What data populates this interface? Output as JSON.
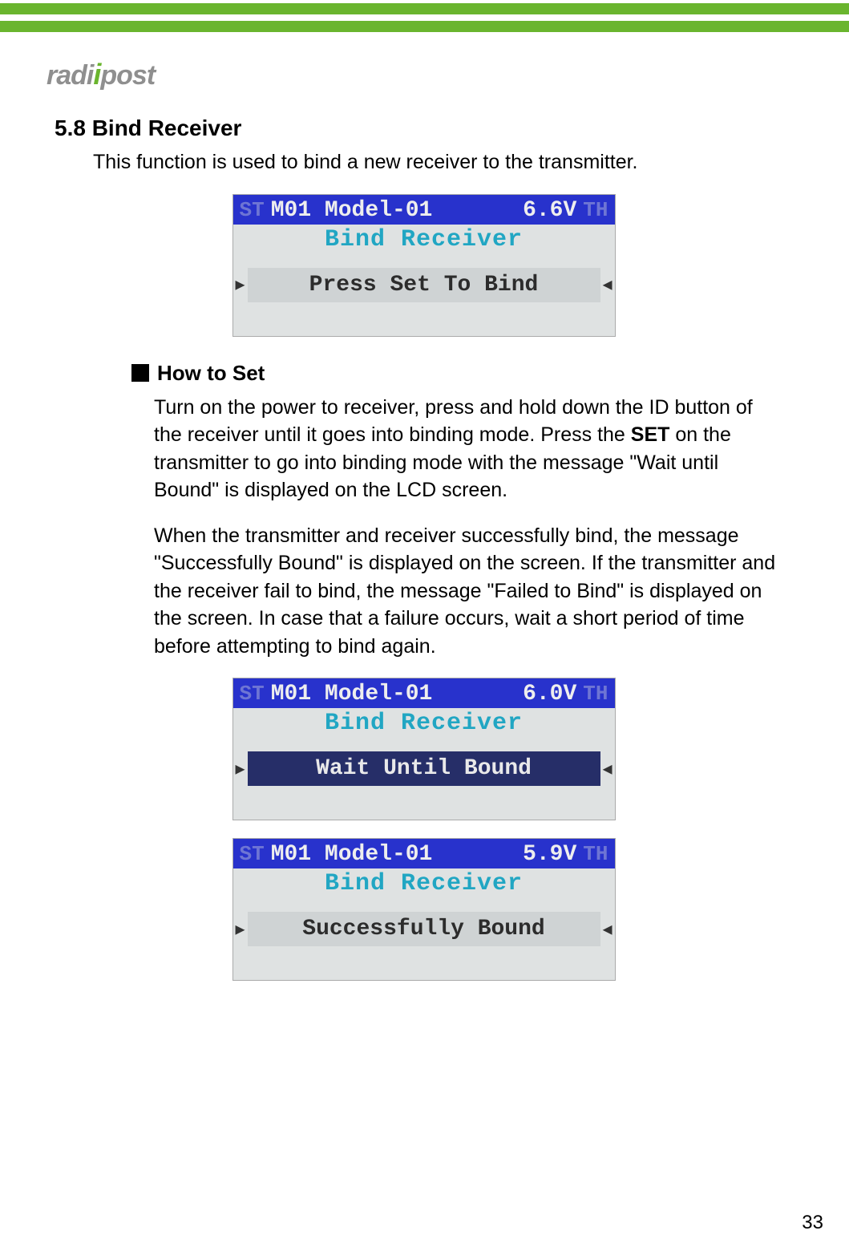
{
  "logo": {
    "pre": "radi",
    "accent": "i",
    "post": "post"
  },
  "section": {
    "title": "5.8 Bind Receiver",
    "lead": "This function is used to bind a new receiver to the transmitter.",
    "sub": "How to Set",
    "p1a": "Turn on the power to receiver, press and hold down the ID button of the receiver until it goes into binding mode. Press the ",
    "p1b": "SET",
    "p1c": " on the transmitter to go into binding mode with the message \"Wait until Bound\" is displayed on the LCD screen.",
    "p2": "When the transmitter and receiver successfully bind, the message \"Successfully Bound\" is displayed on the screen. If the transmitter and the receiver fail to bind, the message \"Failed to Bind\" is displayed on the screen. In case that a failure occurs, wait a short period of time before attempting to bind again."
  },
  "lcd": [
    {
      "st": "ST",
      "model": "M01 Model-01",
      "volt": "6.6V",
      "th": "TH",
      "title": "Bind Receiver",
      "bar": "Press Set To Bind",
      "inverse": false
    },
    {
      "st": "ST",
      "model": "M01 Model-01",
      "volt": "6.0V",
      "th": "TH",
      "title": "Bind Receiver",
      "bar": "Wait Until Bound",
      "inverse": true
    },
    {
      "st": "ST",
      "model": "M01 Model-01",
      "volt": "5.9V",
      "th": "TH",
      "title": "Bind Receiver",
      "bar": "Successfully Bound",
      "inverse": false
    }
  ],
  "page_number": "33"
}
